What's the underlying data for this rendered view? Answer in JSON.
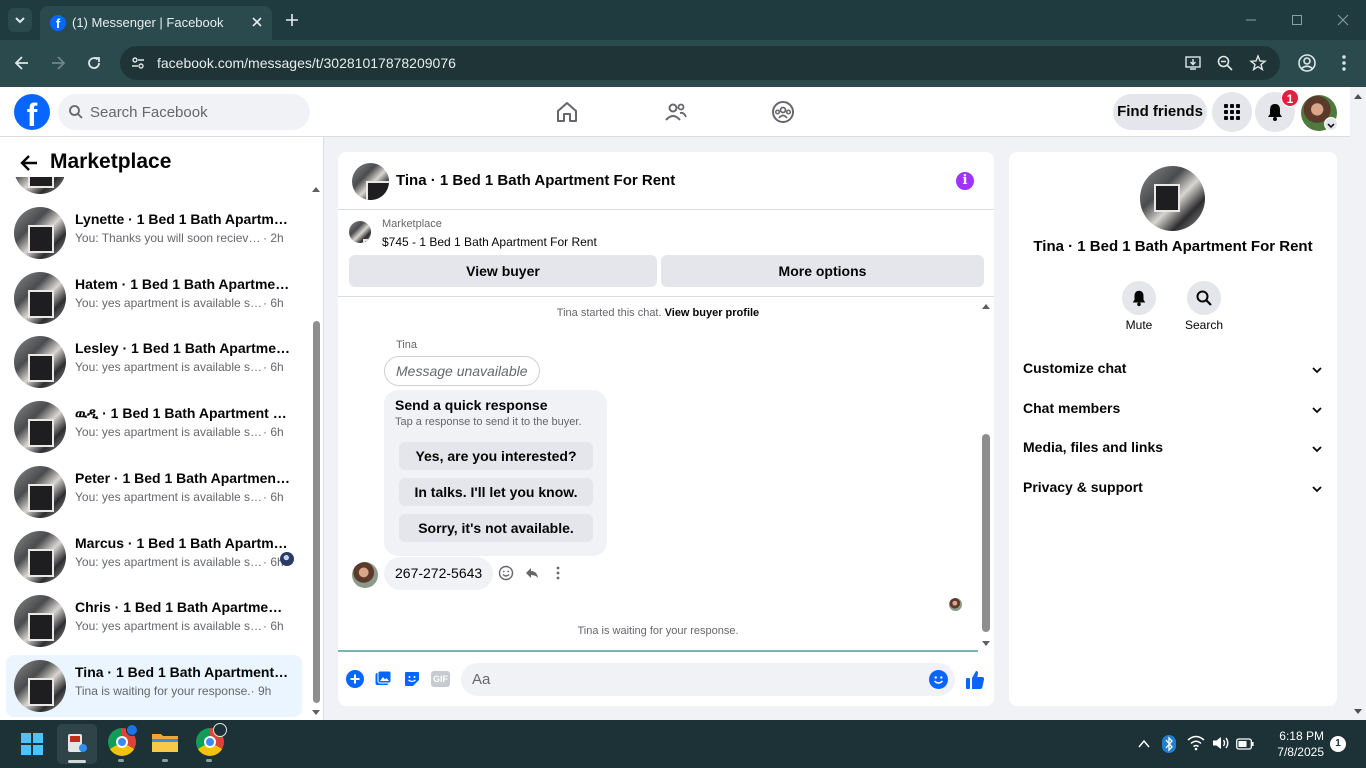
{
  "browser": {
    "tab_title": "(1) Messenger | Facebook",
    "url": "facebook.com/messages/t/30281017878209076"
  },
  "fb_header": {
    "search_placeholder": "Search Facebook",
    "find_friends": "Find friends",
    "notif_count": "1"
  },
  "sidebar": {
    "title": "Marketplace",
    "partial_text": "You: ......... 2h",
    "conversations": [
      {
        "name": "Lynette · 1 Bed 1 Bath Apartment For Rent",
        "preview": "You: Thanks you will soon recieve a code",
        "time": "· 2h"
      },
      {
        "name": "Hatem · 1 Bed 1 Bath Apartment For Rent",
        "preview": "You: yes apartment is available share",
        "time": "· 6h"
      },
      {
        "name": "Lesley · 1 Bed 1 Bath Apartment For Rent",
        "preview": "You: yes apartment is available share",
        "time": "· 6h"
      },
      {
        "name": "ዉዲ · 1 Bed 1 Bath Apartment For Rent",
        "preview": "You: yes apartment is available share",
        "time": "· 6h"
      },
      {
        "name": "Peter · 1 Bed 1 Bath Apartment For Rent",
        "preview": "You: yes apartment is available share",
        "time": "· 6h"
      },
      {
        "name": "Marcus · 1 Bed 1 Bath Apartment For Rent",
        "preview": "You: yes apartment is available share",
        "time": "· 6h"
      },
      {
        "name": "Chris · 1 Bed 1 Bath Apartment For Rent",
        "preview": "You: yes apartment is available share",
        "time": "· 6h"
      },
      {
        "name": "Tina · 1 Bed 1 Bath Apartment For Rent",
        "preview": "Tina is waiting for your response.",
        "time": "· 9h"
      }
    ]
  },
  "chat": {
    "title": "Tina · 1 Bed 1 Bath Apartment For Rent",
    "listing_label": "Marketplace",
    "listing": "$745 - 1 Bed 1 Bath Apartment For Rent",
    "view_buyer": "View buyer",
    "more_options": "More options",
    "started_text": "Tina started this chat.",
    "view_profile": "View buyer profile",
    "sender": "Tina",
    "unavailable": "Message unavailable",
    "quick_title": "Send a quick response",
    "quick_sub": "Tap a response to send it to the buyer.",
    "quick_options": [
      "Yes, are you interested?",
      "In talks. I'll let you know.",
      "Sorry, it's not available."
    ],
    "phone": "267-272-5643",
    "waiting": "Tina is waiting for your response.",
    "composer_placeholder": "Aa",
    "gif": "GIF"
  },
  "info": {
    "title": "Tina · 1 Bed 1 Bath Apartment For Rent",
    "mute": "Mute",
    "search": "Search",
    "sections": [
      "Customize chat",
      "Chat members",
      "Media, files and links",
      "Privacy & support"
    ]
  },
  "taskbar": {
    "time": "6:18 PM",
    "date": "7/8/2025",
    "notif": "1"
  },
  "colors": {
    "fb_blue": "#0866ff",
    "messenger_purple": "#a033ff",
    "badge_red": "#e41e3f"
  }
}
